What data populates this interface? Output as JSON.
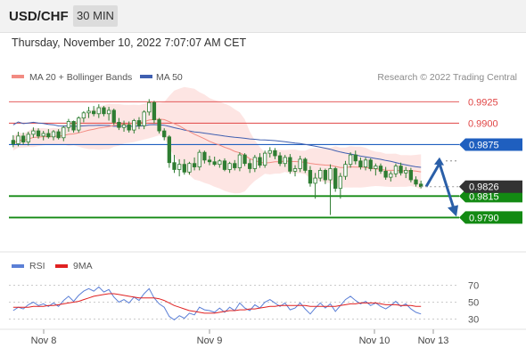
{
  "header": {
    "symbol": "USD/CHF",
    "timeframe": "30 MIN"
  },
  "datetime": "Thursday, November 10, 2022 7:07:07 AM CET",
  "legend": {
    "ma20": "MA 20 + Bollinger Bands",
    "ma50": "MA 50",
    "credit": "Research © 2022 Trading Central",
    "rsi": "RSI",
    "rsi_ma": "9MA"
  },
  "colors": {
    "candle": "#2e7d32",
    "ma20": "#f28b82",
    "bollinger_fill": "#fde0de",
    "ma50": "#3f5fb0",
    "resistance": "#e04545",
    "pivot": "#1f5fbf",
    "support": "#138a13",
    "last_price": "#333333",
    "rsi": "#5b7fd6",
    "rsi_ma": "#e02020",
    "arrow": "#2a5fa8"
  },
  "chart_data": [
    {
      "type": "candlestick",
      "title": "",
      "ylim": [
        0.975,
        0.9945
      ],
      "x_ticks": [
        "Nov 8",
        "Nov 9",
        "Nov 10",
        "Nov 13"
      ],
      "levels": [
        {
          "value": 0.9925,
          "label": "0.9925",
          "role": "resistance"
        },
        {
          "value": 0.99,
          "label": "0.9900",
          "role": "resistance"
        },
        {
          "value": 0.9875,
          "label": "0.9875",
          "role": "pivot"
        },
        {
          "value": 0.9815,
          "label": "0.9815",
          "role": "support"
        },
        {
          "value": 0.979,
          "label": "0.9790",
          "role": "support"
        }
      ],
      "last_price": {
        "value": 0.9826,
        "label": "0.9826"
      },
      "scenario": {
        "direction": "down",
        "from": 0.9826,
        "alternative_high": 0.9856,
        "target": 0.979
      },
      "ohlc": [
        [
          0.988,
          0.9886,
          0.9872,
          0.9876
        ],
        [
          0.9876,
          0.989,
          0.9873,
          0.9885
        ],
        [
          0.9885,
          0.9889,
          0.9875,
          0.9878
        ],
        [
          0.9878,
          0.989,
          0.9874,
          0.9887
        ],
        [
          0.9887,
          0.9895,
          0.9883,
          0.9891
        ],
        [
          0.9891,
          0.9894,
          0.9882,
          0.9885
        ],
        [
          0.9885,
          0.9891,
          0.988,
          0.9888
        ],
        [
          0.9888,
          0.9893,
          0.9882,
          0.9884
        ],
        [
          0.9884,
          0.9892,
          0.988,
          0.989
        ],
        [
          0.989,
          0.9893,
          0.9881,
          0.9883
        ],
        [
          0.9883,
          0.9897,
          0.9879,
          0.9895
        ],
        [
          0.9895,
          0.9905,
          0.989,
          0.9902
        ],
        [
          0.9902,
          0.9903,
          0.9889,
          0.9892
        ],
        [
          0.9892,
          0.9908,
          0.9889,
          0.9906
        ],
        [
          0.9906,
          0.9914,
          0.9901,
          0.9912
        ],
        [
          0.9912,
          0.9919,
          0.9906,
          0.9914
        ],
        [
          0.9914,
          0.992,
          0.9908,
          0.9911
        ],
        [
          0.9911,
          0.9922,
          0.9906,
          0.9918
        ],
        [
          0.9918,
          0.992,
          0.9908,
          0.9911
        ],
        [
          0.9911,
          0.9919,
          0.9903,
          0.9915
        ],
        [
          0.9915,
          0.9917,
          0.9898,
          0.9901
        ],
        [
          0.9901,
          0.9906,
          0.9892,
          0.9895
        ],
        [
          0.9895,
          0.9903,
          0.989,
          0.9898
        ],
        [
          0.9898,
          0.9902,
          0.9889,
          0.9892
        ],
        [
          0.9892,
          0.9905,
          0.9888,
          0.9903
        ],
        [
          0.9903,
          0.9907,
          0.9893,
          0.9897
        ],
        [
          0.9897,
          0.9915,
          0.9893,
          0.9913
        ],
        [
          0.9913,
          0.9928,
          0.9909,
          0.9924
        ],
        [
          0.9924,
          0.9926,
          0.99,
          0.9904
        ],
        [
          0.9904,
          0.9906,
          0.9888,
          0.9891
        ],
        [
          0.9891,
          0.9894,
          0.988,
          0.9884
        ],
        [
          0.9884,
          0.9886,
          0.9848,
          0.9854
        ],
        [
          0.9854,
          0.9863,
          0.9842,
          0.9846
        ],
        [
          0.9846,
          0.9858,
          0.9838,
          0.9852
        ],
        [
          0.9852,
          0.9858,
          0.984,
          0.9843
        ],
        [
          0.9843,
          0.9855,
          0.984,
          0.9853
        ],
        [
          0.9853,
          0.986,
          0.9845,
          0.9849
        ],
        [
          0.9849,
          0.9869,
          0.9845,
          0.9866
        ],
        [
          0.9866,
          0.9868,
          0.9853,
          0.9857
        ],
        [
          0.9857,
          0.9862,
          0.9851,
          0.9855
        ],
        [
          0.9855,
          0.9861,
          0.985,
          0.9852
        ],
        [
          0.9852,
          0.9858,
          0.9848,
          0.9856
        ],
        [
          0.9856,
          0.9859,
          0.9844,
          0.9846
        ],
        [
          0.9846,
          0.9855,
          0.9842,
          0.9853
        ],
        [
          0.9853,
          0.9857,
          0.9845,
          0.9848
        ],
        [
          0.9848,
          0.9866,
          0.9844,
          0.9863
        ],
        [
          0.9863,
          0.9865,
          0.985,
          0.9853
        ],
        [
          0.9853,
          0.9858,
          0.9842,
          0.9847
        ],
        [
          0.9847,
          0.9863,
          0.9843,
          0.986
        ],
        [
          0.986,
          0.9865,
          0.9848,
          0.9851
        ],
        [
          0.9851,
          0.9868,
          0.9848,
          0.9865
        ],
        [
          0.9865,
          0.9872,
          0.986,
          0.9868
        ],
        [
          0.9868,
          0.9871,
          0.9858,
          0.9862
        ],
        [
          0.9862,
          0.9866,
          0.985,
          0.9853
        ],
        [
          0.9853,
          0.9863,
          0.9849,
          0.986
        ],
        [
          0.986,
          0.9864,
          0.9841,
          0.9844
        ],
        [
          0.9844,
          0.9851,
          0.9838,
          0.9847
        ],
        [
          0.9847,
          0.9862,
          0.9843,
          0.9858
        ],
        [
          0.9858,
          0.986,
          0.9842,
          0.9845
        ],
        [
          0.9845,
          0.985,
          0.9826,
          0.983
        ],
        [
          0.983,
          0.9842,
          0.9812,
          0.9836
        ],
        [
          0.9836,
          0.9848,
          0.9832,
          0.9845
        ],
        [
          0.9845,
          0.9847,
          0.9829,
          0.9834
        ],
        [
          0.9834,
          0.9852,
          0.9793,
          0.9847
        ],
        [
          0.9847,
          0.9849,
          0.982,
          0.9824
        ],
        [
          0.9824,
          0.9842,
          0.9812,
          0.9838
        ],
        [
          0.9838,
          0.9856,
          0.9834,
          0.9852
        ],
        [
          0.9852,
          0.9866,
          0.9848,
          0.9863
        ],
        [
          0.9863,
          0.9868,
          0.9852,
          0.9856
        ],
        [
          0.9856,
          0.986,
          0.9846,
          0.9849
        ],
        [
          0.9849,
          0.986,
          0.9845,
          0.9857
        ],
        [
          0.9857,
          0.9859,
          0.9844,
          0.9847
        ],
        [
          0.9847,
          0.9853,
          0.9839,
          0.985
        ],
        [
          0.985,
          0.9853,
          0.9841,
          0.9844
        ],
        [
          0.9844,
          0.9849,
          0.9834,
          0.9837
        ],
        [
          0.9837,
          0.9844,
          0.9832,
          0.9841
        ],
        [
          0.9841,
          0.9853,
          0.9837,
          0.985
        ],
        [
          0.985,
          0.9854,
          0.9839,
          0.9842
        ],
        [
          0.9842,
          0.9849,
          0.9836,
          0.9845
        ],
        [
          0.9845,
          0.9848,
          0.9831,
          0.9834
        ],
        [
          0.9834,
          0.9838,
          0.9826,
          0.9829
        ],
        [
          0.9829,
          0.9833,
          0.9824,
          0.9826
        ]
      ]
    },
    {
      "type": "line",
      "title": "RSI",
      "ylim": [
        20,
        80
      ],
      "y_ticks": [
        70,
        50,
        30
      ],
      "series": [
        {
          "name": "RSI",
          "values": [
            40,
            44,
            42,
            47,
            50,
            46,
            48,
            45,
            49,
            45,
            52,
            57,
            51,
            58,
            63,
            66,
            63,
            68,
            62,
            65,
            56,
            50,
            53,
            49,
            56,
            52,
            60,
            66,
            55,
            48,
            44,
            33,
            29,
            34,
            31,
            37,
            35,
            44,
            41,
            40,
            38,
            43,
            38,
            44,
            40,
            49,
            43,
            40,
            47,
            43,
            50,
            53,
            49,
            45,
            49,
            41,
            43,
            49,
            42,
            36,
            43,
            49,
            43,
            48,
            39,
            46,
            53,
            57,
            52,
            48,
            51,
            46,
            49,
            45,
            42,
            46,
            51,
            45,
            48,
            42,
            38,
            36
          ]
        },
        {
          "name": "9MA",
          "values": [
            44,
            44,
            44,
            44,
            45,
            45,
            45,
            46,
            46,
            47,
            48,
            49,
            50,
            51,
            53,
            55,
            57,
            58,
            59,
            60,
            60,
            59,
            58,
            57,
            56,
            55,
            55,
            55,
            55,
            54,
            52,
            49,
            46,
            44,
            42,
            40,
            39,
            38,
            37,
            37,
            37,
            38,
            39,
            40,
            40,
            41,
            41,
            42,
            42,
            43,
            44,
            45,
            45,
            46,
            46,
            46,
            46,
            46,
            46,
            45,
            45,
            45,
            45,
            45,
            45,
            46,
            47,
            48,
            48,
            49,
            49,
            49,
            49,
            48,
            47,
            47,
            47,
            46,
            46,
            46,
            45,
            45
          ]
        }
      ]
    }
  ]
}
